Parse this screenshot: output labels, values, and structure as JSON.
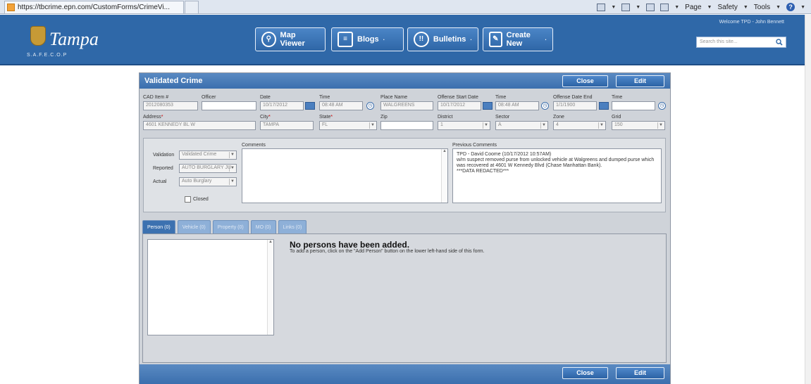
{
  "browser": {
    "url": "https://tbcrime.epn.com/CustomForms/CrimeVi...",
    "toolbar": {
      "page": "Page",
      "safety": "Safety",
      "tools": "Tools"
    }
  },
  "header": {
    "logo_text": "Tampa",
    "logo_sub": "S.A.F.E.C.O.P",
    "nav": [
      {
        "label": "Map Viewer",
        "icon": "map-pin-icon"
      },
      {
        "label": "Blogs",
        "icon": "chat-icon"
      },
      {
        "label": "Bulletins",
        "icon": "bulletin-icon"
      },
      {
        "label": "Create New",
        "icon": "edit-icon"
      }
    ],
    "welcome": "Welcome TPD - John Bennett",
    "search_placeholder": "Search this site..."
  },
  "form": {
    "title": "Validated Crime",
    "close_label": "Close",
    "edit_label": "Edit",
    "row1": {
      "cad_label": "CAD Item #",
      "cad_value": "2012080353",
      "officer_label": "Officer",
      "officer_value": "",
      "date_label": "Date",
      "date_value": "10/17/2012",
      "time_label": "Time",
      "time_value": "08:48 AM",
      "place_label": "Place Name",
      "place_value": "WALGREENS",
      "offstart_label": "Offense Start Date",
      "offstart_value": "10/17/2012",
      "time2_label": "Time",
      "time2_value": "08:48 AM",
      "offend_label": "Offense Date End",
      "offend_value": "1/1/1900",
      "time3_label": "Time",
      "time3_value": ""
    },
    "row2": {
      "address_label": "Address",
      "address_value": "4601 KENNEDY BL W",
      "city_label": "City",
      "city_value": "TAMPA",
      "state_label": "State",
      "state_value": "FL",
      "zip_label": "Zip",
      "zip_value": "",
      "district_label": "District",
      "district_value": "1",
      "sector_label": "Sector",
      "sector_value": "A",
      "zone_label": "Zone",
      "zone_value": "4",
      "grid_label": "Grid",
      "grid_value": "150"
    },
    "validation_label": "Validation",
    "validation_value": "Validated Crime",
    "reported_label": "Reported",
    "reported_value": "AUTO BURGLARY JU",
    "actual_label": "Actual",
    "actual_value": "Auto Burglary",
    "closed_label": "Closed",
    "comments_label": "Comments",
    "prev_comments_label": "Previous Comments",
    "prev_comments": "TPD - David Coome (10/17/2012 10:57AM)\nw/m suspect removed purse from unlocked vehicle at Walgreens and dumped purse which was recovered at 4601 W Kennedy Blvd (Chase Manhattan Bank).\n***DATA REDACTED***",
    "tabs": [
      "Person (0)",
      "Vehicle (0)",
      "Property (0)",
      "MO (0)",
      "Links (0)"
    ],
    "empty_title": "No persons have been added.",
    "empty_sub": "To add a person, click on the \"Add Person\" button on the lower left-hand side of this form."
  }
}
